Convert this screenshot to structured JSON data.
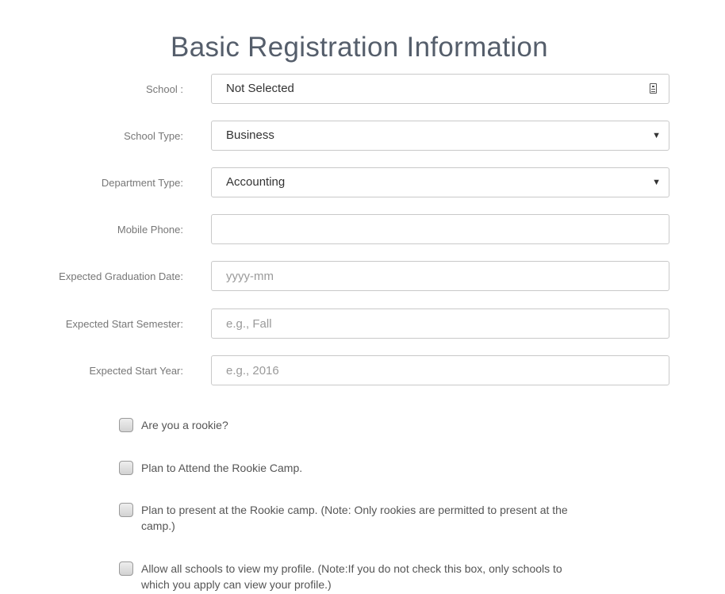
{
  "form": {
    "title": "Basic Registration Information",
    "school": {
      "label": "School :",
      "value": "Not Selected",
      "icon": "id-card-icon"
    },
    "school_type": {
      "label": "School Type:",
      "value": "Business"
    },
    "department_type": {
      "label": "Department Type:",
      "value": "Accounting"
    },
    "mobile_phone": {
      "label": "Mobile Phone:",
      "value": "",
      "placeholder": ""
    },
    "graduation_date": {
      "label": "Expected Graduation Date:",
      "value": "",
      "placeholder": "yyyy-mm"
    },
    "start_semester": {
      "label": "Expected Start Semester:",
      "value": "",
      "placeholder": "e.g., Fall"
    },
    "start_year": {
      "label": "Expected Start Year:",
      "value": "",
      "placeholder": "e.g., 2016"
    },
    "checkboxes": [
      {
        "label": "Are you a rookie?",
        "checked": false
      },
      {
        "label": "Plan to Attend the Rookie Camp.",
        "checked": false
      },
      {
        "label": "Plan to present at the Rookie camp. (Note: Only rookies are permitted to present at the camp.)",
        "checked": false
      },
      {
        "label": "Allow all schools to view my profile. (Note:If you do not check this box, only schools to which you apply can view your profile.)",
        "checked": false
      }
    ]
  }
}
